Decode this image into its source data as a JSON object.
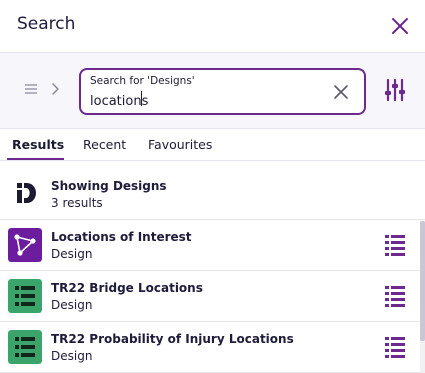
{
  "header": {
    "title": "Search",
    "close_icon": "close-icon"
  },
  "search": {
    "label": "Search for 'Designs'",
    "value": "locations",
    "menu_icon": "menu-icon",
    "chevron_icon": "chevron-right-icon",
    "clear_icon": "clear-icon",
    "filter_icon": "filter-sliders-icon"
  },
  "tabs": [
    {
      "label": "Results",
      "active": true
    },
    {
      "label": "Recent",
      "active": false
    },
    {
      "label": "Favourites",
      "active": false
    }
  ],
  "summary": {
    "title": "Showing Designs",
    "count": "3 results",
    "icon": "designs-logo-icon"
  },
  "results": [
    {
      "title": "Locations of Interest",
      "subtitle": "Design",
      "icon": "graph-nodes-icon",
      "action_icon": "list-details-icon",
      "color": "#6c1d9e"
    },
    {
      "title": "TR22 Bridge Locations",
      "subtitle": "Design",
      "icon": "table-list-icon",
      "action_icon": "list-details-icon",
      "color": "#3aa46a"
    },
    {
      "title": "TR22 Probability of Injury Locations",
      "subtitle": "Design",
      "icon": "table-list-icon",
      "action_icon": "list-details-icon",
      "color": "#3aa46a"
    }
  ],
  "colors": {
    "accent": "#6c2a8f",
    "text": "#1c1b33",
    "divider": "#e6e5ee"
  }
}
